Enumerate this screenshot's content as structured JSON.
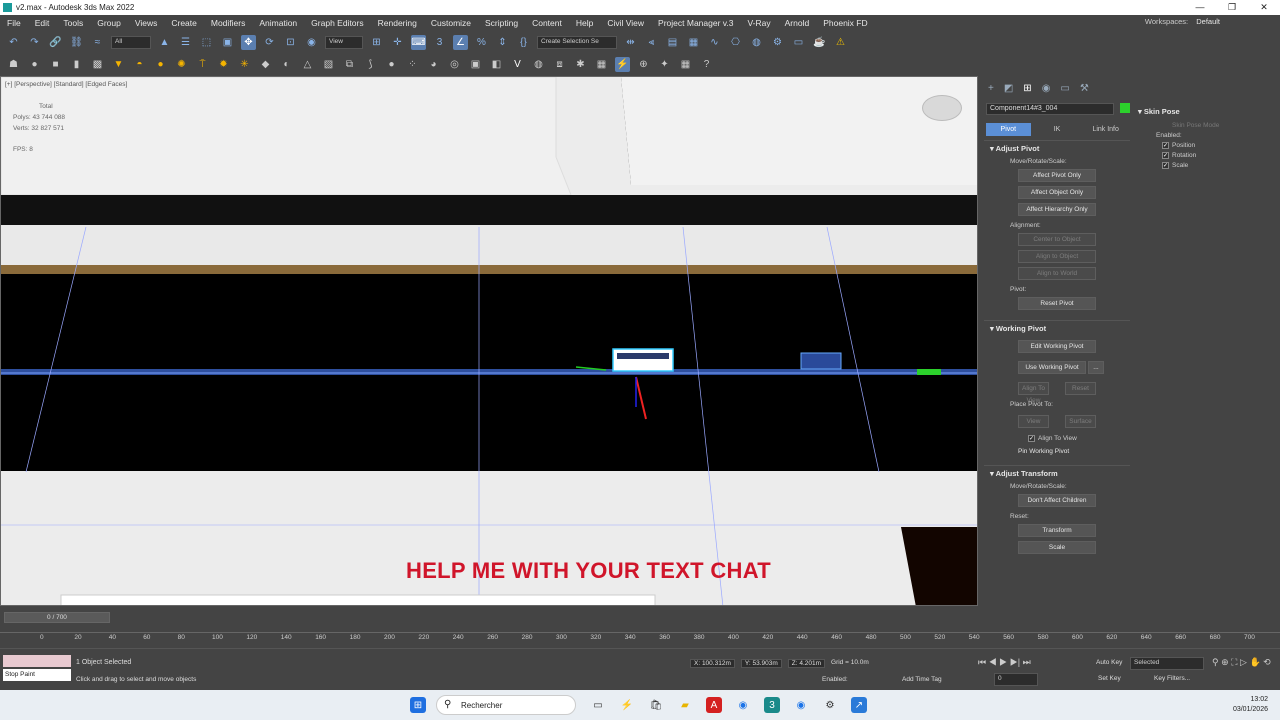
{
  "window": {
    "title": "v2.max - Autodesk 3ds Max 2022"
  },
  "menu": [
    "File",
    "Edit",
    "Tools",
    "Group",
    "Views",
    "Create",
    "Modifiers",
    "Animation",
    "Graph Editors",
    "Rendering",
    "Customize",
    "Scripting",
    "Content",
    "Help",
    "Civil View",
    "Project Manager v.3",
    "V-Ray",
    "Arnold",
    "Phoenix FD"
  ],
  "workspace": {
    "label": "Workspaces:",
    "value": "Default"
  },
  "toolbar": {
    "selection_filter": "All",
    "ref_coord": "View",
    "named_selection": "Create Selection Se"
  },
  "viewport": {
    "label": "[+] [Perspective] [Standard] [Edged Faces]",
    "stats": {
      "total": "Total",
      "polys": "Polys: 43 744 088",
      "verts": "Verts: 32 827 571",
      "fps": "FPS: 8"
    },
    "caption": "HELP ME WITH YOUR TEXT CHAT"
  },
  "command_panel": {
    "object_name": "Component14#3_004",
    "tabs": [
      "Pivot",
      "IK",
      "Link Info"
    ],
    "adjust_pivot": {
      "title": "Adjust Pivot",
      "move_label": "Move/Rotate/Scale:",
      "buttons": [
        "Affect Pivot Only",
        "Affect Object Only",
        "Affect Hierarchy Only"
      ],
      "alignment_label": "Alignment:",
      "align_buttons": [
        "Center to Object",
        "Align to Object",
        "Align to World"
      ],
      "pivot_label": "Pivot:",
      "reset_pivot": "Reset Pivot"
    },
    "working_pivot": {
      "title": "Working Pivot",
      "edit": "Edit Working Pivot",
      "use": "Use Working Pivot",
      "more": "...",
      "align_view": "Align To View",
      "reset": "Reset",
      "place_label": "Place Pivot To:",
      "view": "View",
      "surface": "Surface",
      "align_to_view_chk": "Align To View",
      "pin": "Pin Working Pivot"
    },
    "adjust_transform": {
      "title": "Adjust Transform",
      "move_label": "Move/Rotate/Scale:",
      "dont_affect": "Don't Affect Children",
      "reset_label": "Reset:",
      "transform": "Transform",
      "scale": "Scale"
    }
  },
  "skin_pose": {
    "title": "Skin Pose",
    "mode": "Skin Pose Mode",
    "enabled_label": "Enabled:",
    "position": "Position",
    "rotation": "Rotation",
    "scale": "Scale"
  },
  "timeline": {
    "slider": "0 / 700",
    "ticks": [
      "0",
      "20",
      "40",
      "60",
      "80",
      "100",
      "120",
      "140",
      "160",
      "180",
      "200",
      "220",
      "240",
      "260",
      "280",
      "300",
      "320",
      "340",
      "360",
      "380",
      "400",
      "420",
      "440",
      "460",
      "480",
      "500",
      "520",
      "540",
      "560",
      "580",
      "600",
      "620",
      "640",
      "660",
      "680",
      "700"
    ]
  },
  "status": {
    "maxscript": "Stop Paint",
    "selection": "1 Object Selected",
    "prompt": "Click and drag to select and move objects",
    "x": "X: 100.312m",
    "y": "Y: 53.903m",
    "z": "Z: 4.201m",
    "grid": "Grid = 10.0m",
    "enabled": "Enabled:",
    "add_time_tag": "Add Time Tag",
    "auto_key": "Auto Key",
    "set_key": "Set Key",
    "selected": "Selected",
    "key_filters": "Key Filters...",
    "frame": "0"
  },
  "taskbar": {
    "search": "Rechercher",
    "time": "13:02",
    "date": "03/01/2026"
  },
  "colors": {
    "caption": "#d0152a",
    "active_tab": "#5b8fd6",
    "object_color": "#2cd12c"
  }
}
